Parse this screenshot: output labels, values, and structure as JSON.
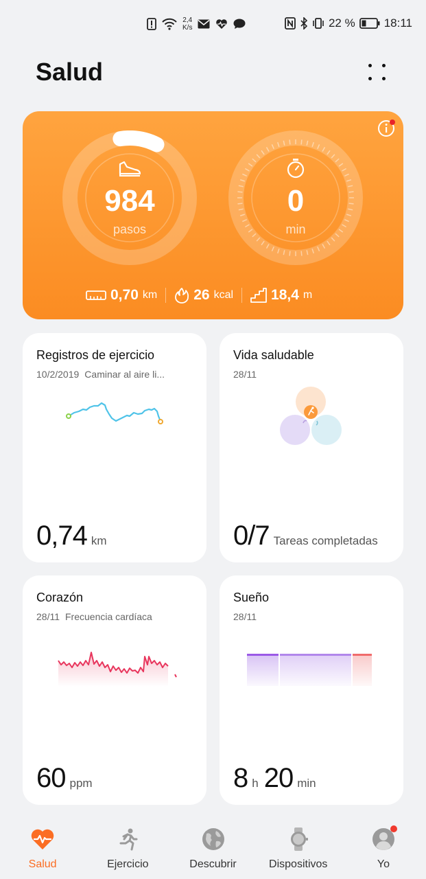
{
  "status_bar": {
    "speed_value": "2,4",
    "speed_unit": "K/s",
    "battery": "22 %",
    "time": "18:11",
    "icons": [
      "alert-icon",
      "wifi-icon",
      "mail-icon",
      "heart-icon",
      "chat-icon",
      "nfc-icon",
      "bluetooth-icon",
      "vibrate-icon",
      "battery-icon"
    ]
  },
  "header": {
    "title": "Salud",
    "menu_icon": "four-dots-icon"
  },
  "activity": {
    "steps_value": "984",
    "steps_unit": "pasos",
    "steps_progress": 0.1,
    "time_value": "0",
    "time_unit": "min",
    "distance_value": "0,70",
    "distance_unit": "km",
    "calories_value": "26",
    "calories_unit": "kcal",
    "floors_value": "18,4",
    "floors_unit": "m",
    "info_icon": "info-icon"
  },
  "cards": {
    "exercise": {
      "title": "Registros de ejercicio",
      "date": "10/2/2019",
      "activity": "Caminar al aire li...",
      "value": "0,74",
      "unit": "km"
    },
    "healthy": {
      "title": "Vida saludable",
      "date": "28/11",
      "value": "0/7",
      "unit": "Tareas completadas"
    },
    "heart": {
      "title": "Corazón",
      "date": "28/11",
      "subtitle": "Frecuencia cardíaca",
      "value": "60",
      "unit": "ppm"
    },
    "sleep": {
      "title": "Sueño",
      "date": "28/11",
      "hours": "8",
      "hours_unit": "h",
      "minutes": "20",
      "minutes_unit": "min"
    }
  },
  "nav": {
    "items": [
      {
        "label": "Salud",
        "icon": "heart-rate-icon",
        "active": true
      },
      {
        "label": "Ejercicio",
        "icon": "runner-icon",
        "active": false
      },
      {
        "label": "Descubrir",
        "icon": "globe-icon",
        "active": false
      },
      {
        "label": "Dispositivos",
        "icon": "watch-icon",
        "active": false
      },
      {
        "label": "Yo",
        "icon": "profile-icon",
        "active": false
      }
    ]
  },
  "colors": {
    "accent": "#fb6d23",
    "card_orange_top": "#ffa43f",
    "card_orange_bottom": "#fb8c22",
    "route_line": "#4fc3e8",
    "heart_line": "#e8365d",
    "sleep_deep": "#9b59e6",
    "sleep_awake": "#f06b6b"
  }
}
